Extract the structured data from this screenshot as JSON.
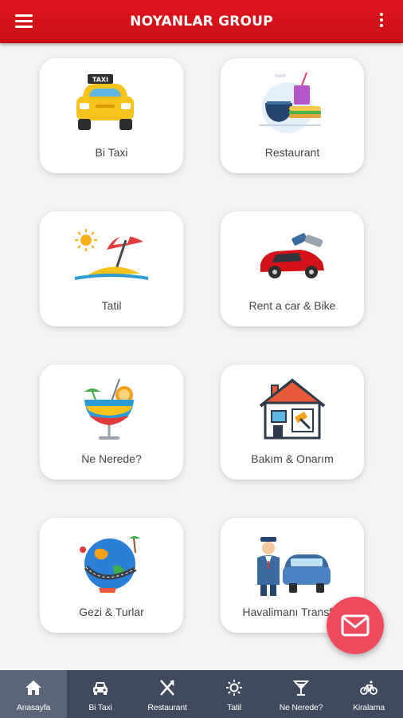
{
  "appbar": {
    "title": "NOYANLAR GROUP",
    "menu_icon": "hamburger-menu-icon",
    "more_icon": "more-vertical-icon"
  },
  "colors": {
    "primary": "#d4121a",
    "fab": "#ef4a5c",
    "bottom_nav": "#404a5e",
    "bottom_nav_active": "#5b6579"
  },
  "cards": [
    {
      "label": "Bi Taxi",
      "icon": "taxi-icon"
    },
    {
      "label": "Restaurant",
      "icon": "restaurant-food-icon"
    },
    {
      "label": "Tatil",
      "icon": "beach-umbrella-icon"
    },
    {
      "label": "Rent a car & Bike",
      "icon": "red-car-key-icon"
    },
    {
      "label": "Ne Nerede?",
      "icon": "cocktail-icon"
    },
    {
      "label": "Bakım & Onarım",
      "icon": "house-repair-icon"
    },
    {
      "label": "Gezi & Turlar",
      "icon": "globe-tour-icon"
    },
    {
      "label": "Havalimanı Transfer",
      "icon": "airport-driver-car-icon"
    }
  ],
  "taxi_sign": "TAXI",
  "fab": {
    "icon": "mail-icon"
  },
  "bottom_nav": [
    {
      "label": "Anasayfa",
      "icon": "home-icon",
      "active": true
    },
    {
      "label": "Bi Taxi",
      "icon": "car-icon",
      "active": false
    },
    {
      "label": "Restaurant",
      "icon": "fork-knife-icon",
      "active": false
    },
    {
      "label": "Tatil",
      "icon": "sun-icon",
      "active": false
    },
    {
      "label": "Ne Nerede?",
      "icon": "cocktail-glass-icon",
      "active": false
    },
    {
      "label": "Kiralama",
      "icon": "bicycle-icon",
      "active": false
    }
  ]
}
